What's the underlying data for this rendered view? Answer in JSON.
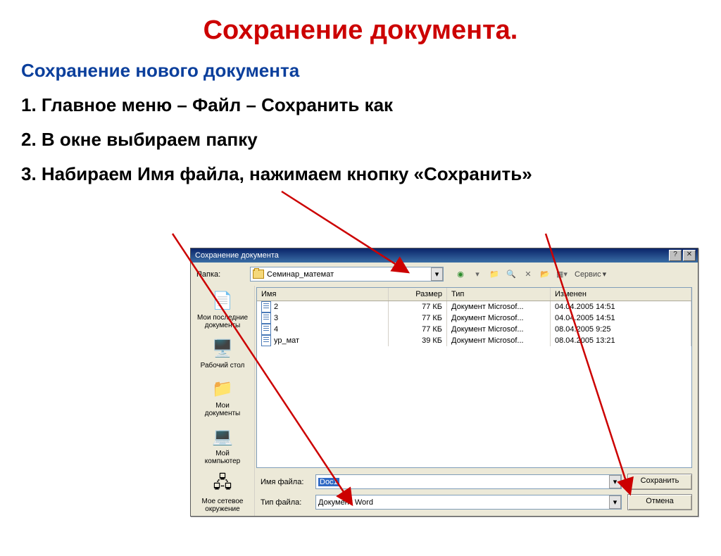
{
  "title": "Сохранение документа.",
  "subtitle": "Сохранение нового документа",
  "steps": {
    "s1": "1. Главное меню – Файл – Сохранить как",
    "s2": "2. В окне выбираем папку",
    "s3": "3. Набираем Имя файла, нажимаем кнопку «Сохранить»"
  },
  "dialog": {
    "title": "Сохранение документа",
    "folder_label": "Папка:",
    "folder_value": "Семинар_математ",
    "tools_label": "Сервис",
    "columns": {
      "name": "Имя",
      "size": "Размер",
      "type": "Тип",
      "mod": "Изменен"
    },
    "files": [
      {
        "name": "2",
        "size": "77 КБ",
        "type": "Документ Microsof...",
        "mod": "04.04.2005 14:51"
      },
      {
        "name": "3",
        "size": "77 КБ",
        "type": "Документ Microsof...",
        "mod": "04.04.2005 14:51"
      },
      {
        "name": "4",
        "size": "77 КБ",
        "type": "Документ Microsof...",
        "mod": "08.04.2005 9:25"
      },
      {
        "name": "ур_мат",
        "size": "39 КБ",
        "type": "Документ Microsof...",
        "mod": "08.04.2005 13:21"
      }
    ],
    "places": {
      "recent": "Мои последние\nдокументы",
      "desktop": "Рабочий стол",
      "docs": "Мои\nдокументы",
      "computer": "Мой\nкомпьютер",
      "network": "Мое сетевое\nокружение"
    },
    "filename_label": "Имя файла:",
    "filename_value": "Doc1",
    "filetype_label": "Тип файла:",
    "filetype_value": "Документ Word",
    "save_btn": "Сохранить",
    "cancel_btn": "Отмена"
  }
}
